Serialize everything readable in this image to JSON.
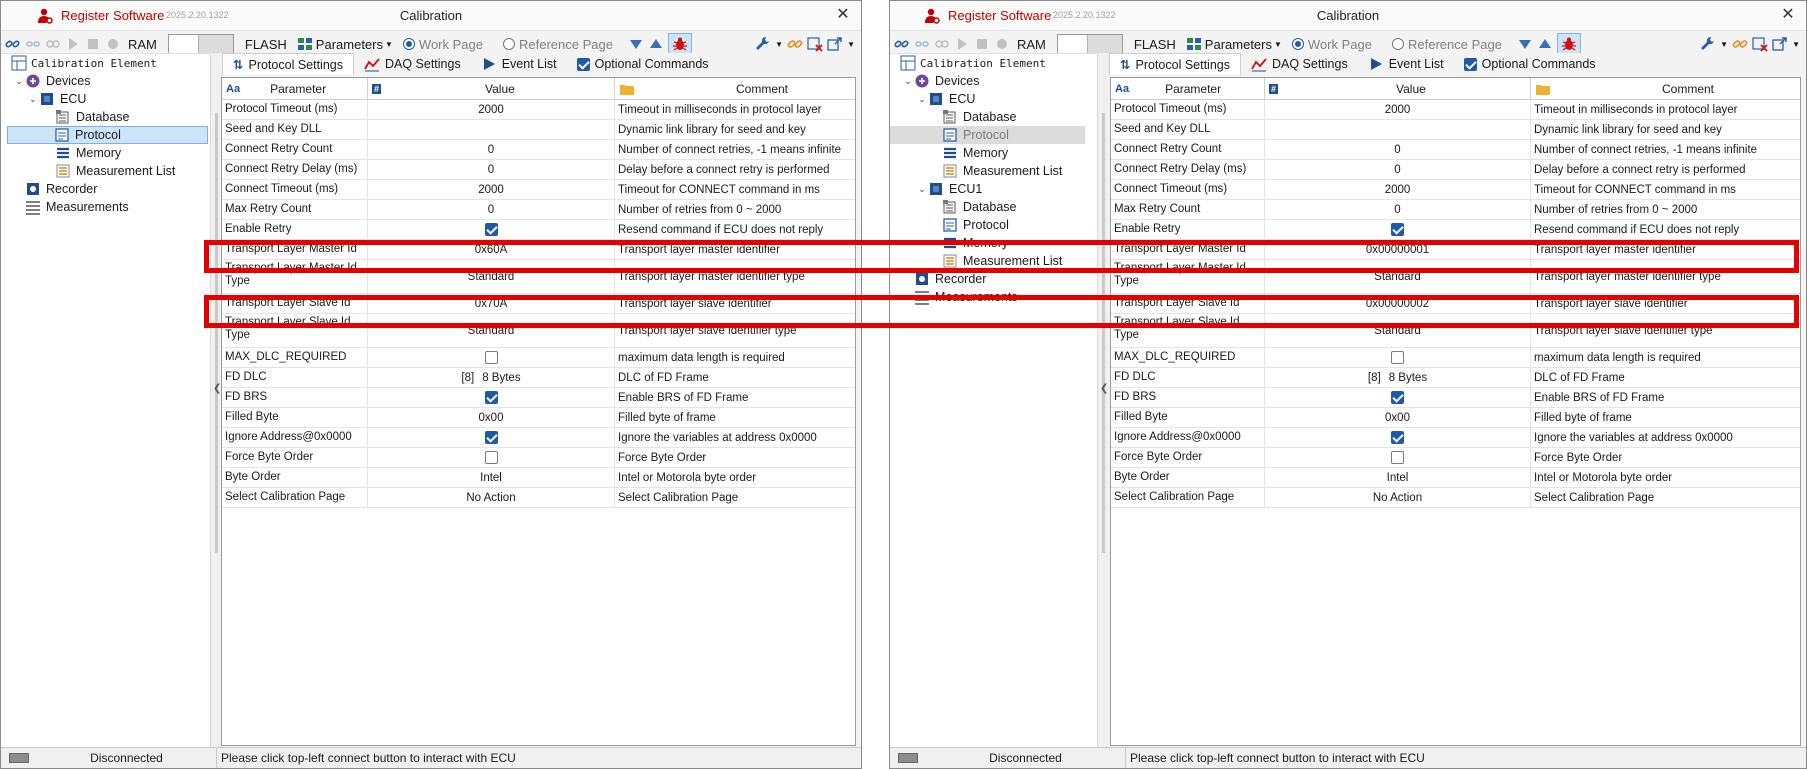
{
  "app": {
    "name": "Register Software",
    "version": "2025.2.20.1322",
    "window_title": "Calibration",
    "accent_color": "#c00000"
  },
  "toolbar": {
    "ram_label": "RAM",
    "flash_label": "FLASH",
    "parameters_label": "Parameters",
    "work_page_label": "Work Page",
    "reference_page_label": "Reference Page"
  },
  "tree": {
    "header": "Calibration Element",
    "devices": "Devices",
    "ecu": "ECU",
    "ecu1": "ECU1",
    "database": "Database",
    "protocol": "Protocol",
    "memory": "Memory",
    "measurement_list": "Measurement List",
    "recorder": "Recorder",
    "measurements": "Measurements"
  },
  "tabs": {
    "protocol_settings": "Protocol Settings",
    "daq_settings": "DAQ Settings",
    "event_list": "Event List",
    "optional_commands": "Optional Commands"
  },
  "grid": {
    "col_parameter": "Parameter",
    "col_value": "Value",
    "col_comment": "Comment",
    "col_parameter_icon": "Aa",
    "col_value_icon": "#"
  },
  "left_rows": [
    {
      "param": "Protocol Timeout (ms)",
      "value": "2000",
      "comment": "Timeout in milliseconds in protocol layer"
    },
    {
      "param": "Seed and Key DLL",
      "value": "",
      "comment": "Dynamic link library for seed and key"
    },
    {
      "param": "Connect Retry Count",
      "value": "0",
      "comment": "Number of connect retries, -1 means infinite"
    },
    {
      "param": "Connect Retry Delay (ms)",
      "value": "0",
      "comment": "Delay before a connect retry is performed"
    },
    {
      "param": "Connect Timeout (ms)",
      "value": "2000",
      "comment": "Timeout for CONNECT command in ms"
    },
    {
      "param": "Max Retry Count",
      "value": "0",
      "comment": "Number of retries from 0 ~ 2000"
    },
    {
      "param": "Enable Retry",
      "value": "",
      "check": true,
      "comment": "Resend command if ECU does not reply"
    },
    {
      "param": "Transport Layer Master Id",
      "value": "0x60A",
      "comment": "Transport layer master identifier"
    },
    {
      "param": "Transport Layer Master Id Type",
      "value": "Standard",
      "comment": "Transport layer master identifier type",
      "tall": true
    },
    {
      "param": "Transport Layer Slave Id",
      "value": "0x70A",
      "comment": "Transport layer slave identifier"
    },
    {
      "param": "Transport Layer Slave Id Type",
      "value": "Standard",
      "comment": "Transport layer slave identifier type",
      "tall": true
    },
    {
      "param": "MAX_DLC_REQUIRED",
      "value": "",
      "check": false,
      "comment": "maximum data length is required"
    },
    {
      "param": "FD DLC",
      "value": "8 Bytes",
      "index": "[8]",
      "comment": "DLC of FD Frame"
    },
    {
      "param": "FD BRS",
      "value": "",
      "check": true,
      "comment": "Enable BRS of FD Frame"
    },
    {
      "param": "Filled Byte",
      "value": "0x00",
      "comment": "Filled byte of frame"
    },
    {
      "param": "Ignore Address@0x0000",
      "value": "",
      "check": true,
      "comment": "Ignore the variables at address 0x0000"
    },
    {
      "param": "Force Byte Order",
      "value": "",
      "check": false,
      "comment": "Force Byte Order"
    },
    {
      "param": "Byte Order",
      "value": "Intel",
      "comment": "Intel or Motorola byte order"
    },
    {
      "param": "Select Calibration Page",
      "value": "No Action",
      "comment": "Select Calibration Page"
    }
  ],
  "right_rows": [
    {
      "param": "Protocol Timeout (ms)",
      "value": "2000",
      "comment": "Timeout in milliseconds in protocol layer"
    },
    {
      "param": "Seed and Key DLL",
      "value": "",
      "comment": "Dynamic link library for seed and key"
    },
    {
      "param": "Connect Retry Count",
      "value": "0",
      "comment": "Number of connect retries, -1 means infinite"
    },
    {
      "param": "Connect Retry Delay (ms)",
      "value": "0",
      "comment": "Delay before a connect retry is performed"
    },
    {
      "param": "Connect Timeout (ms)",
      "value": "2000",
      "comment": "Timeout for CONNECT command in ms"
    },
    {
      "param": "Max Retry Count",
      "value": "0",
      "comment": "Number of retries from 0 ~ 2000"
    },
    {
      "param": "Enable Retry",
      "value": "",
      "check": true,
      "comment": "Resend command if ECU does not reply"
    },
    {
      "param": "Transport Layer Master Id",
      "value": "0x00000001",
      "comment": "Transport layer master identifier"
    },
    {
      "param": "Transport Layer Master Id Type",
      "value": "Standard",
      "comment": "Transport layer master identifier type",
      "tall": true
    },
    {
      "param": "Transport Layer Slave Id",
      "value": "0x00000002",
      "comment": "Transport layer slave identifier"
    },
    {
      "param": "Transport Layer Slave Id Type",
      "value": "Standard",
      "comment": "Transport layer slave identifier type",
      "tall": true
    },
    {
      "param": "MAX_DLC_REQUIRED",
      "value": "",
      "check": false,
      "comment": "maximum data length is required"
    },
    {
      "param": "FD DLC",
      "value": "8 Bytes",
      "index": "[8]",
      "comment": "DLC of FD Frame"
    },
    {
      "param": "FD BRS",
      "value": "",
      "check": true,
      "comment": "Enable BRS of FD Frame"
    },
    {
      "param": "Filled Byte",
      "value": "0x00",
      "comment": "Filled byte of frame"
    },
    {
      "param": "Ignore Address@0x0000",
      "value": "",
      "check": true,
      "comment": "Ignore the variables at address 0x0000"
    },
    {
      "param": "Force Byte Order",
      "value": "",
      "check": false,
      "comment": "Force Byte Order"
    },
    {
      "param": "Byte Order",
      "value": "Intel",
      "comment": "Intel or Motorola byte order"
    },
    {
      "param": "Select Calibration Page",
      "value": "No Action",
      "comment": "Select Calibration Page"
    }
  ],
  "status": {
    "connection": "Disconnected",
    "message": "Please click top-left connect button to interact with ECU"
  },
  "highlight_color": "#e30000"
}
